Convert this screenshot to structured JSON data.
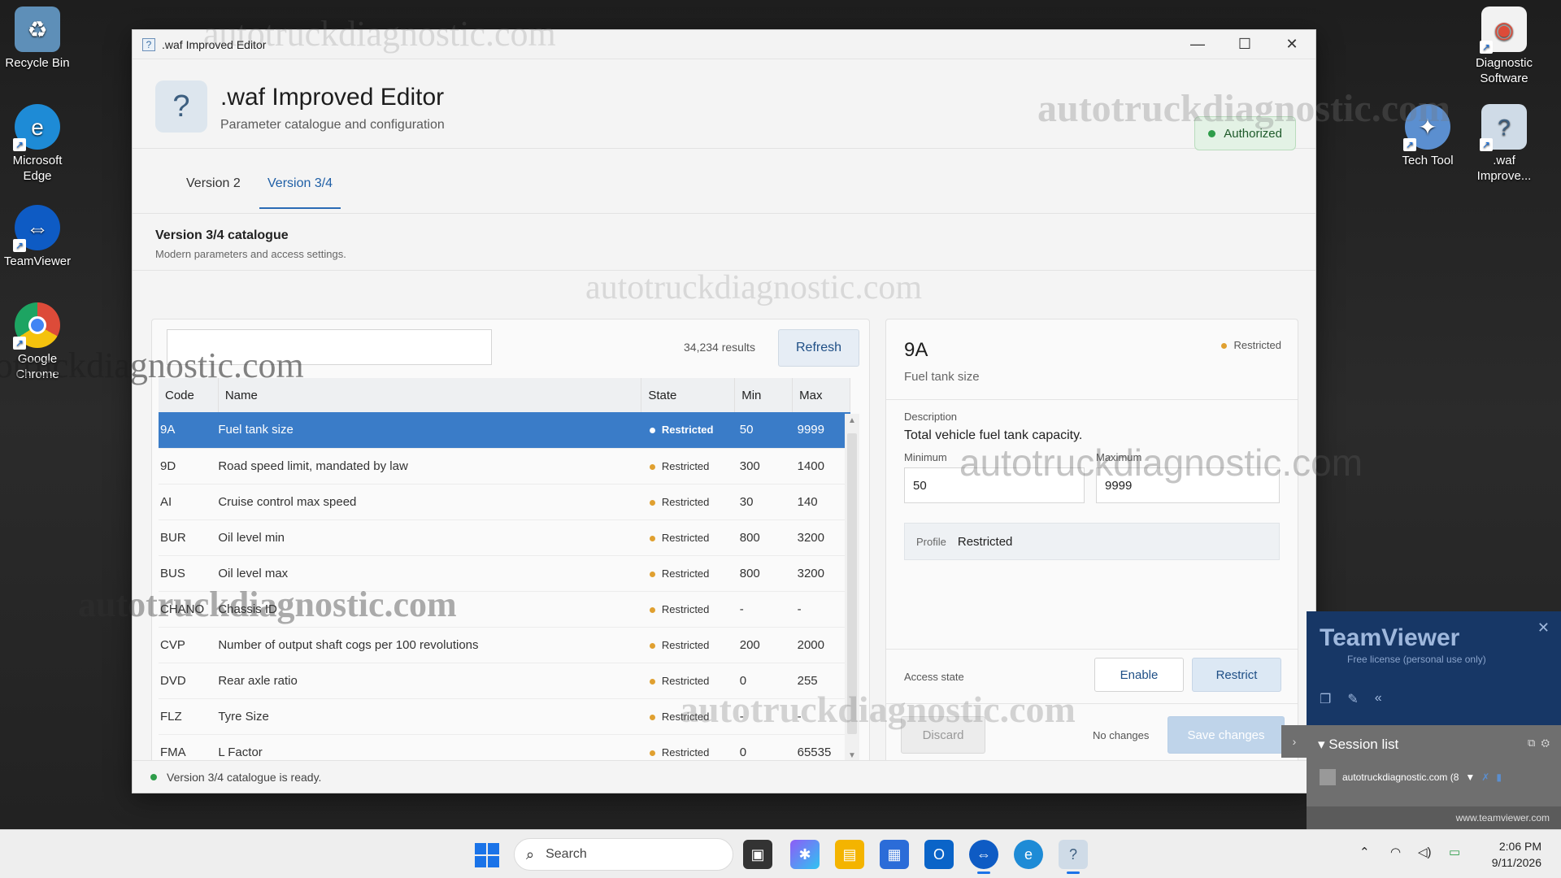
{
  "desktop": {
    "icons_left": [
      {
        "name": "recycle-bin",
        "label": "Recycle Bin",
        "color": "#6fa8dc"
      },
      {
        "name": "microsoft-edge",
        "label": "Microsoft Edge",
        "color": "#1e8bd6"
      },
      {
        "name": "teamviewer",
        "label": "TeamViewer",
        "color": "#0e5bc4"
      },
      {
        "name": "google-chrome",
        "label": "Google Chrome",
        "color": "#dd4b39"
      }
    ],
    "icons_right": [
      {
        "name": "diagnostic-software",
        "label": "Diagnostic Software",
        "color": "#e9e9e9"
      },
      {
        "name": "tech-tool",
        "label": "Tech Tool",
        "color": "#5b8fd0"
      },
      {
        "name": "waf-improve",
        "label": ".waf Improve...",
        "color": "#cfdbe7"
      }
    ]
  },
  "window": {
    "title": ".waf Improved Editor",
    "app_title": ".waf Improved Editor",
    "app_subtitle": "Parameter catalogue and configuration",
    "auth_badge": "Authorized",
    "tabs": [
      {
        "label": "Version 2",
        "active": false
      },
      {
        "label": "Version 3/4",
        "active": true
      }
    ],
    "section_title": "Version 3/4 catalogue",
    "section_subtitle": "Modern parameters and access settings.",
    "search": {
      "value": "",
      "placeholder": ""
    },
    "results_count": "34,234 results",
    "refresh_label": "Refresh",
    "columns": [
      "Code",
      "Name",
      "State",
      "Min",
      "Max"
    ],
    "rows": [
      {
        "code": "9A",
        "name": "Fuel tank size",
        "state": "Restricted",
        "min": "50",
        "max": "9999",
        "selected": true
      },
      {
        "code": "9D",
        "name": "Road speed limit, mandated by law",
        "state": "Restricted",
        "min": "300",
        "max": "1400"
      },
      {
        "code": "AI",
        "name": "Cruise control max speed",
        "state": "Restricted",
        "min": "30",
        "max": "140"
      },
      {
        "code": "BUR",
        "name": "Oil level min",
        "state": "Restricted",
        "min": "800",
        "max": "3200"
      },
      {
        "code": "BUS",
        "name": "Oil level max",
        "state": "Restricted",
        "min": "800",
        "max": "3200"
      },
      {
        "code": "CHANO",
        "name": "Chassis ID",
        "state": "Restricted",
        "min": "-",
        "max": "-"
      },
      {
        "code": "CVP",
        "name": "Number of output shaft cogs per 100 revolutions",
        "state": "Restricted",
        "min": "200",
        "max": "2000"
      },
      {
        "code": "DVD",
        "name": "Rear axle ratio",
        "state": "Restricted",
        "min": "0",
        "max": "255"
      },
      {
        "code": "FLZ",
        "name": "Tyre Size",
        "state": "Restricted",
        "min": "-",
        "max": "-"
      },
      {
        "code": "FMA",
        "name": "L Factor",
        "state": "Restricted",
        "min": "0",
        "max": "65535"
      }
    ],
    "detail": {
      "code": "9A",
      "name": "Fuel tank size",
      "status": "Restricted",
      "description_label": "Description",
      "description": "Total vehicle fuel tank capacity.",
      "minimum_label": "Minimum",
      "minimum": "50",
      "maximum_label": "Maximum",
      "maximum": "9999",
      "profile_label": "Profile",
      "profile": "Restricted",
      "access_label": "Access state",
      "enable_label": "Enable",
      "restrict_label": "Restrict",
      "discard_label": "Discard",
      "no_changes": "No changes",
      "save_label": "Save changes"
    },
    "status_message": "Version 3/4 catalogue is ready."
  },
  "teamviewer": {
    "logo": "TeamViewer",
    "license": "Free license (personal use only)",
    "session_header": "Session list",
    "session_item": "autotruckdiagnostic.com (8",
    "footer": "www.teamviewer.com"
  },
  "taskbar": {
    "search_label": "Search",
    "time": "2:06 PM",
    "date": "9/11/2026"
  },
  "watermark": "autotruckdiagnostic.com",
  "colors": {
    "accent": "#3a7cc8",
    "restricted_dot": "#e0a030",
    "ok_dot": "#2e9d4a"
  }
}
